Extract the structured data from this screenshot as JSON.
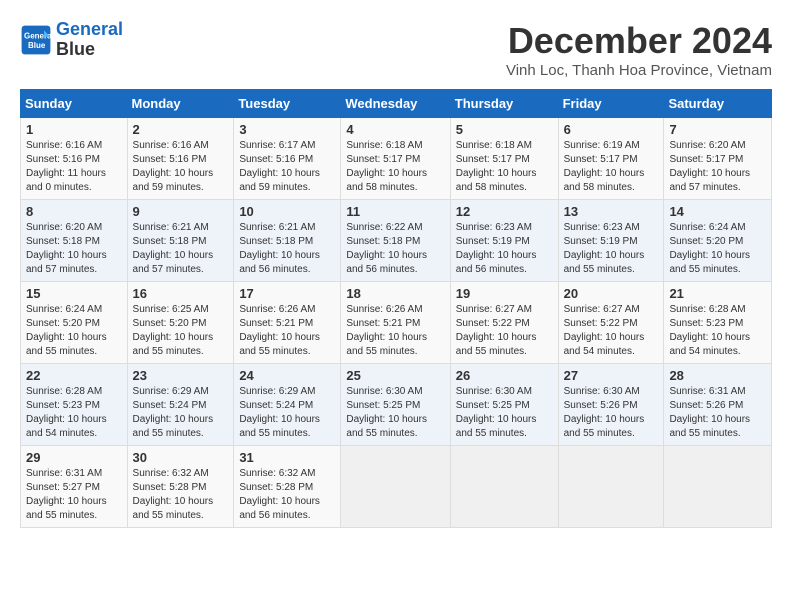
{
  "header": {
    "logo_line1": "General",
    "logo_line2": "Blue",
    "month_title": "December 2024",
    "subtitle": "Vinh Loc, Thanh Hoa Province, Vietnam"
  },
  "weekdays": [
    "Sunday",
    "Monday",
    "Tuesday",
    "Wednesday",
    "Thursday",
    "Friday",
    "Saturday"
  ],
  "weeks": [
    [
      {
        "day": "1",
        "info": "Sunrise: 6:16 AM\nSunset: 5:16 PM\nDaylight: 11 hours\nand 0 minutes."
      },
      {
        "day": "2",
        "info": "Sunrise: 6:16 AM\nSunset: 5:16 PM\nDaylight: 10 hours\nand 59 minutes."
      },
      {
        "day": "3",
        "info": "Sunrise: 6:17 AM\nSunset: 5:16 PM\nDaylight: 10 hours\nand 59 minutes."
      },
      {
        "day": "4",
        "info": "Sunrise: 6:18 AM\nSunset: 5:17 PM\nDaylight: 10 hours\nand 58 minutes."
      },
      {
        "day": "5",
        "info": "Sunrise: 6:18 AM\nSunset: 5:17 PM\nDaylight: 10 hours\nand 58 minutes."
      },
      {
        "day": "6",
        "info": "Sunrise: 6:19 AM\nSunset: 5:17 PM\nDaylight: 10 hours\nand 58 minutes."
      },
      {
        "day": "7",
        "info": "Sunrise: 6:20 AM\nSunset: 5:17 PM\nDaylight: 10 hours\nand 57 minutes."
      }
    ],
    [
      {
        "day": "8",
        "info": "Sunrise: 6:20 AM\nSunset: 5:18 PM\nDaylight: 10 hours\nand 57 minutes."
      },
      {
        "day": "9",
        "info": "Sunrise: 6:21 AM\nSunset: 5:18 PM\nDaylight: 10 hours\nand 57 minutes."
      },
      {
        "day": "10",
        "info": "Sunrise: 6:21 AM\nSunset: 5:18 PM\nDaylight: 10 hours\nand 56 minutes."
      },
      {
        "day": "11",
        "info": "Sunrise: 6:22 AM\nSunset: 5:18 PM\nDaylight: 10 hours\nand 56 minutes."
      },
      {
        "day": "12",
        "info": "Sunrise: 6:23 AM\nSunset: 5:19 PM\nDaylight: 10 hours\nand 56 minutes."
      },
      {
        "day": "13",
        "info": "Sunrise: 6:23 AM\nSunset: 5:19 PM\nDaylight: 10 hours\nand 55 minutes."
      },
      {
        "day": "14",
        "info": "Sunrise: 6:24 AM\nSunset: 5:20 PM\nDaylight: 10 hours\nand 55 minutes."
      }
    ],
    [
      {
        "day": "15",
        "info": "Sunrise: 6:24 AM\nSunset: 5:20 PM\nDaylight: 10 hours\nand 55 minutes."
      },
      {
        "day": "16",
        "info": "Sunrise: 6:25 AM\nSunset: 5:20 PM\nDaylight: 10 hours\nand 55 minutes."
      },
      {
        "day": "17",
        "info": "Sunrise: 6:26 AM\nSunset: 5:21 PM\nDaylight: 10 hours\nand 55 minutes."
      },
      {
        "day": "18",
        "info": "Sunrise: 6:26 AM\nSunset: 5:21 PM\nDaylight: 10 hours\nand 55 minutes."
      },
      {
        "day": "19",
        "info": "Sunrise: 6:27 AM\nSunset: 5:22 PM\nDaylight: 10 hours\nand 55 minutes."
      },
      {
        "day": "20",
        "info": "Sunrise: 6:27 AM\nSunset: 5:22 PM\nDaylight: 10 hours\nand 54 minutes."
      },
      {
        "day": "21",
        "info": "Sunrise: 6:28 AM\nSunset: 5:23 PM\nDaylight: 10 hours\nand 54 minutes."
      }
    ],
    [
      {
        "day": "22",
        "info": "Sunrise: 6:28 AM\nSunset: 5:23 PM\nDaylight: 10 hours\nand 54 minutes."
      },
      {
        "day": "23",
        "info": "Sunrise: 6:29 AM\nSunset: 5:24 PM\nDaylight: 10 hours\nand 55 minutes."
      },
      {
        "day": "24",
        "info": "Sunrise: 6:29 AM\nSunset: 5:24 PM\nDaylight: 10 hours\nand 55 minutes."
      },
      {
        "day": "25",
        "info": "Sunrise: 6:30 AM\nSunset: 5:25 PM\nDaylight: 10 hours\nand 55 minutes."
      },
      {
        "day": "26",
        "info": "Sunrise: 6:30 AM\nSunset: 5:25 PM\nDaylight: 10 hours\nand 55 minutes."
      },
      {
        "day": "27",
        "info": "Sunrise: 6:30 AM\nSunset: 5:26 PM\nDaylight: 10 hours\nand 55 minutes."
      },
      {
        "day": "28",
        "info": "Sunrise: 6:31 AM\nSunset: 5:26 PM\nDaylight: 10 hours\nand 55 minutes."
      }
    ],
    [
      {
        "day": "29",
        "info": "Sunrise: 6:31 AM\nSunset: 5:27 PM\nDaylight: 10 hours\nand 55 minutes."
      },
      {
        "day": "30",
        "info": "Sunrise: 6:32 AM\nSunset: 5:28 PM\nDaylight: 10 hours\nand 55 minutes."
      },
      {
        "day": "31",
        "info": "Sunrise: 6:32 AM\nSunset: 5:28 PM\nDaylight: 10 hours\nand 56 minutes."
      },
      {
        "day": "",
        "info": ""
      },
      {
        "day": "",
        "info": ""
      },
      {
        "day": "",
        "info": ""
      },
      {
        "day": "",
        "info": ""
      }
    ]
  ]
}
